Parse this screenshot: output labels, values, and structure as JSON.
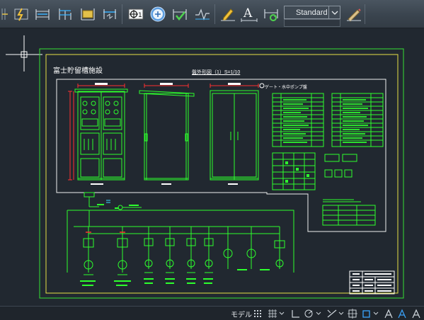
{
  "toolbar": {
    "text_style": "Standard",
    "icons": [
      "dimension-break-icon",
      "dimension-space-icon",
      "dimension-baseline-icon",
      "dimension-continue-icon",
      "dimension-jogged-icon",
      "center-mark-icon",
      "inspect-dimension-icon",
      "jogged-linear-icon",
      "dimension-edit-icon",
      "dimension-text-edit-icon",
      "dimension-update-icon",
      "dimension-style-icon"
    ]
  },
  "drawing": {
    "project_title": "富士貯留槽施設",
    "sheet_title": "盤外形図（1）S=1/10",
    "pump_note": "ゲート・水中ポンプ盤"
  },
  "statusbar": {
    "model_tab": "モデル",
    "icons": [
      "grid-icon",
      "snap-icon",
      "ortho-icon",
      "polar-icon",
      "object-snap-icon",
      "annotation-scale-icon",
      "workspace-icon"
    ]
  }
}
